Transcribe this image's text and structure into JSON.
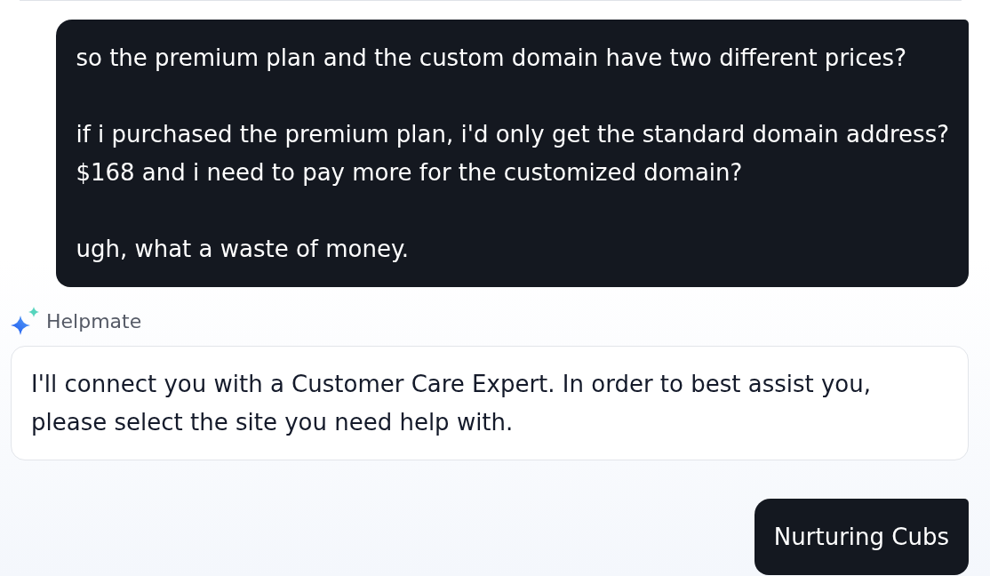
{
  "conversation": [
    {
      "kind": "user",
      "text": "so the premium plan and the custom domain have two different prices?\n\nif i purchased the premium plan, i'd only get the standard domain address?\n$168 and i need to pay more for the customized domain?\n\nugh, what a waste of money."
    },
    {
      "kind": "assistant",
      "sender": "Helpmate",
      "text": "I'll connect you with a Customer Care Expert. In order to best assist you, please select the site you need help with."
    },
    {
      "kind": "user",
      "text": "Nurturing Cubs"
    }
  ]
}
